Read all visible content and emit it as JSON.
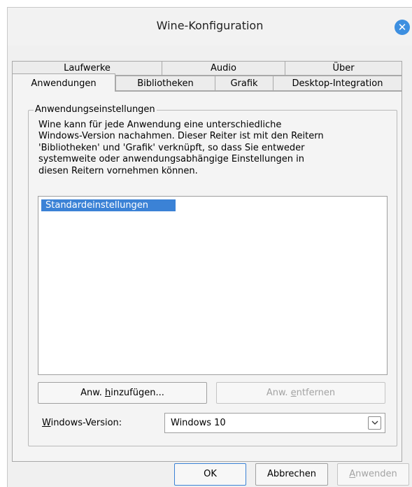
{
  "window": {
    "title": "Wine-Konfiguration"
  },
  "tabs": {
    "row1": [
      "Laufwerke",
      "Audio",
      "Über"
    ],
    "row2": [
      "Anwendungen",
      "Bibliotheken",
      "Grafik",
      "Desktop-Integration"
    ],
    "active": "Anwendungen"
  },
  "group": {
    "title": "Anwendungseinstellungen",
    "description_lines": [
      "Wine kann für jede Anwendung eine unterschiedliche",
      "Windows-Version nachahmen. Dieser Reiter ist mit den Reitern",
      "'Bibliotheken' und 'Grafik' verknüpft, so dass Sie entweder",
      "systemweite oder anwendungsabhängige Einstellungen in",
      "diesen Reitern vornehmen können."
    ],
    "applications": [
      "Standardeinstellungen"
    ],
    "add_button": {
      "pre": "Anw. ",
      "accel": "h",
      "post": "inzufügen..."
    },
    "remove_button": {
      "pre": "Anw. ",
      "accel": "e",
      "post": "ntfernen"
    },
    "version_label": {
      "accel": "W",
      "post": "indows-Version:"
    },
    "version_value": "Windows 10"
  },
  "buttons": {
    "ok": "OK",
    "cancel": "Abbrechen",
    "apply": {
      "accel": "A",
      "post": "nwenden"
    }
  },
  "colors": {
    "accent": "#3b82d6",
    "close": "#3d8fe0",
    "disabled_text": "#a3a3a3"
  }
}
